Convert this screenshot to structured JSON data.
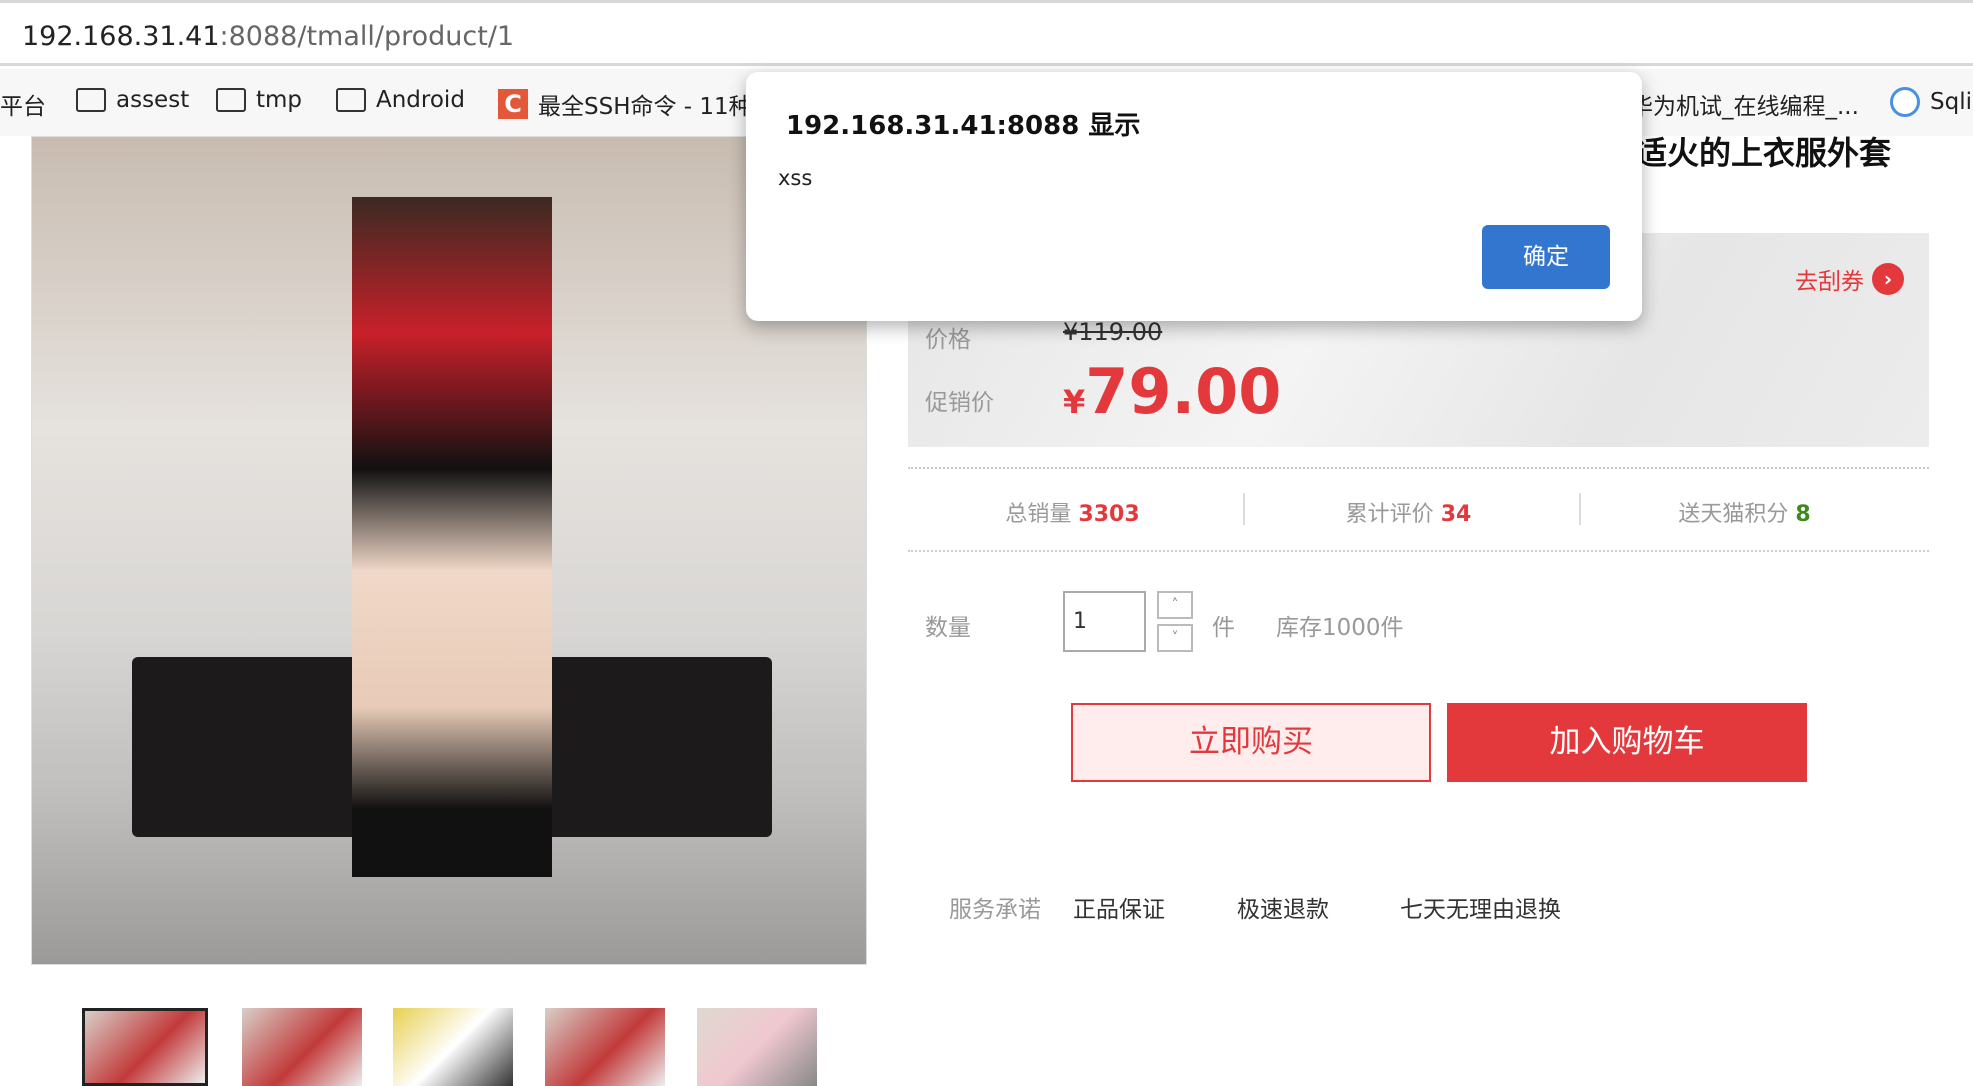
{
  "browser": {
    "url_host": "192.168.31.41",
    "url_path": ":8088/tmall/product/1",
    "bookmarks": [
      {
        "label": "平台",
        "icon": "none"
      },
      {
        "label": "assest",
        "icon": "folder-icon"
      },
      {
        "label": "tmp",
        "icon": "folder-icon"
      },
      {
        "label": "Android",
        "icon": "folder-icon"
      },
      {
        "label": "最全SSH命令 - 11种",
        "icon": "csdn-icon"
      },
      {
        "label": "华为机试_在线编程_...",
        "icon": "none"
      },
      {
        "label": "Sqli",
        "icon": "site-icon"
      }
    ]
  },
  "product": {
    "title_fragment": "适火的上衣服外套",
    "coupon_label": "去刮券",
    "price_label": "价格",
    "original_price": "¥119.00",
    "promo_label": "促销价",
    "promo_currency": "¥",
    "promo_price": "79.00",
    "stats": [
      {
        "label": "总销量",
        "value": "3303",
        "color": "#e4393c"
      },
      {
        "label": "累计评价",
        "value": "34",
        "color": "#e4393c"
      },
      {
        "label": "送天猫积分",
        "value": "8",
        "color": "#3f8a1e"
      }
    ],
    "quantity_label": "数量",
    "quantity_value": "1",
    "unit": "件",
    "stock": "库存1000件",
    "buy_now": "立即购买",
    "add_to_cart": "加入购物车",
    "service_label": "服务承诺",
    "services": [
      "正品保证",
      "极速退款",
      "七天无理由退换"
    ]
  },
  "dialog": {
    "title": "192.168.31.41:8088 显示",
    "message": "xss",
    "ok": "确定"
  }
}
